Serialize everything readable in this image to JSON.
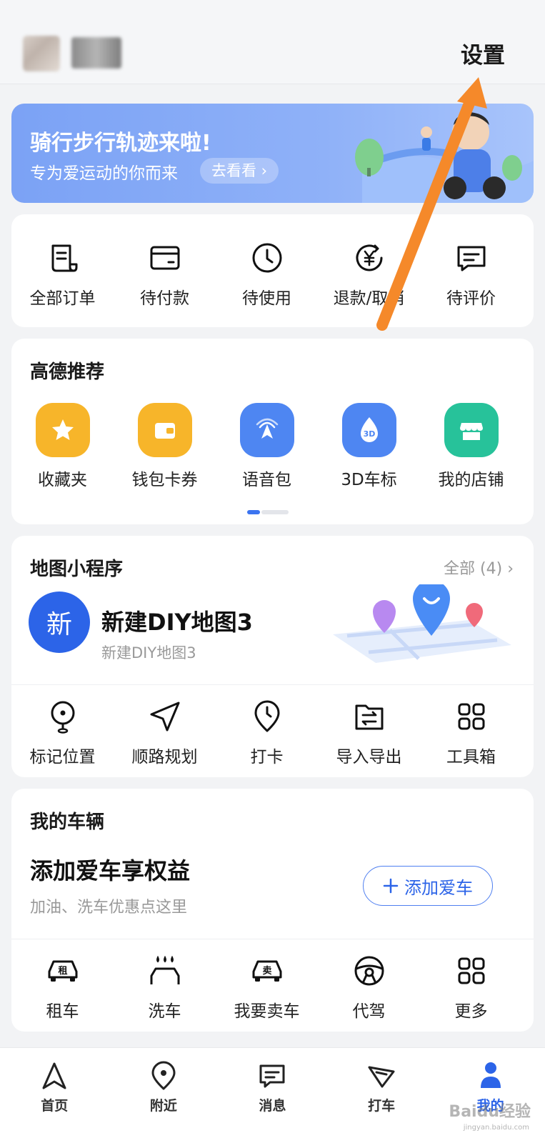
{
  "header": {
    "settings_label": "设置"
  },
  "banner": {
    "title": "骑行步行轨迹来啦!",
    "subtitle": "专为爱运动的你而来",
    "button_label": "去看看 ›"
  },
  "orders": {
    "items": [
      {
        "label": "全部订单",
        "icon": "receipt-icon"
      },
      {
        "label": "待付款",
        "icon": "wallet-icon"
      },
      {
        "label": "待使用",
        "icon": "clock-icon"
      },
      {
        "label": "退款/取消",
        "icon": "refund-icon"
      },
      {
        "label": "待评价",
        "icon": "comment-icon"
      }
    ]
  },
  "recommend": {
    "title": "高德推荐",
    "items": [
      {
        "label": "收藏夹",
        "icon": "star-icon",
        "color": "#f7b52a"
      },
      {
        "label": "钱包卡券",
        "icon": "wallet-icon",
        "color": "#f7b52a"
      },
      {
        "label": "语音包",
        "icon": "voice-arrow-icon",
        "color": "#4e86f2"
      },
      {
        "label": "3D车标",
        "icon": "3d-drop-icon",
        "color": "#4e86f2"
      },
      {
        "label": "我的店铺",
        "icon": "shop-icon",
        "color": "#27c29a"
      }
    ]
  },
  "miniprogram": {
    "title": "地图小程序",
    "more_label": "全部 (4) ›",
    "diy_avatar_text": "新",
    "diy_title": "新建DIY地图3",
    "diy_subtitle": "新建DIY地图3",
    "tools": [
      {
        "label": "标记位置",
        "icon": "pin-icon"
      },
      {
        "label": "顺路规划",
        "icon": "navigate-icon"
      },
      {
        "label": "打卡",
        "icon": "checkin-icon"
      },
      {
        "label": "导入导出",
        "icon": "import-export-icon"
      },
      {
        "label": "工具箱",
        "icon": "grid-icon"
      }
    ]
  },
  "vehicle": {
    "title": "我的车辆",
    "headline": "添加爱车享权益",
    "subtitle": "加油、洗车优惠点这里",
    "add_button_label": "添加爱车",
    "services": [
      {
        "label": "租车",
        "icon": "rent-car-icon",
        "badge": "租"
      },
      {
        "label": "洗车",
        "icon": "car-wash-icon"
      },
      {
        "label": "我要卖车",
        "icon": "sell-car-icon",
        "badge": "卖"
      },
      {
        "label": "代驾",
        "icon": "steering-wheel-icon"
      },
      {
        "label": "更多",
        "icon": "grid-icon"
      }
    ]
  },
  "tabbar": {
    "items": [
      {
        "label": "首页",
        "icon": "home-arrow-icon"
      },
      {
        "label": "附近",
        "icon": "location-icon"
      },
      {
        "label": "消息",
        "icon": "message-icon"
      },
      {
        "label": "打车",
        "icon": "taxi-icon"
      },
      {
        "label": "我的",
        "icon": "profile-icon",
        "active": true
      }
    ]
  },
  "colors": {
    "accent": "#2c64e8",
    "annotation_arrow": "#f5892a"
  },
  "watermark": {
    "text": "Baidu经验",
    "sub": "jingyan.baidu.com"
  }
}
